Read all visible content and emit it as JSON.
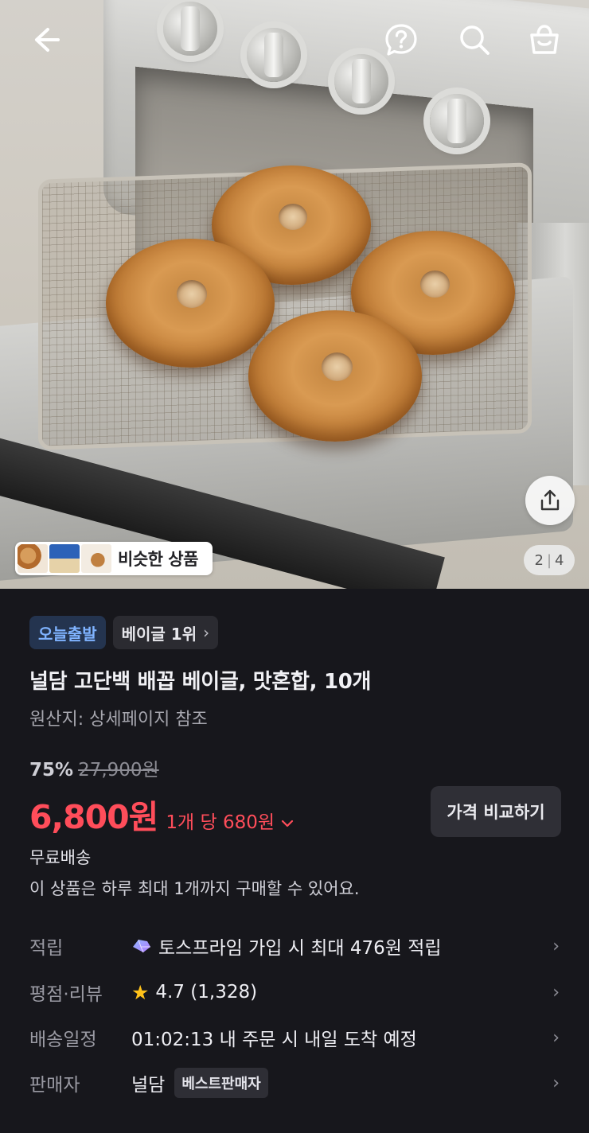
{
  "header": {
    "back_icon": "arrow-left-icon",
    "help_icon": "question-circle-icon",
    "search_icon": "search-icon",
    "cart_icon": "shopping-bag-icon"
  },
  "gallery": {
    "similar_label": "비슷한 상품",
    "current_page": "2",
    "total_pages": "4"
  },
  "tags": {
    "today": "오늘출발",
    "rank": "베이글 1위",
    "rank_chevron": "›"
  },
  "product": {
    "title": "널담 고단백 배꼽 베이글, 맛혼합, 10개",
    "origin": "원산지: 상세페이지 참조",
    "discount": "75%",
    "original_price": "27,900원",
    "price": "6,800원",
    "unit_price": "1개 당 680원",
    "compare_label": "가격 비교하기",
    "shipping": "무료배송",
    "limit_note": "이 상품은 하루 최대 1개까지 구매할 수 있어요."
  },
  "info": {
    "points": {
      "label": "적립",
      "value": "토스프라임 가입 시 최대 476원 적립"
    },
    "rating": {
      "label": "평점·리뷰",
      "value": "4.7 (1,328)"
    },
    "delivery": {
      "label": "배송일정",
      "value": "01:02:13 내 주문 시 내일 도착 예정"
    },
    "seller": {
      "label": "판매자",
      "value": "널담",
      "badge": "베스트판매자"
    },
    "chevron": "›"
  },
  "colors": {
    "background": "#17171c",
    "price_red": "#ff4d5a",
    "today_tag_text": "#7fb3ff",
    "star": "#ffc21a"
  }
}
